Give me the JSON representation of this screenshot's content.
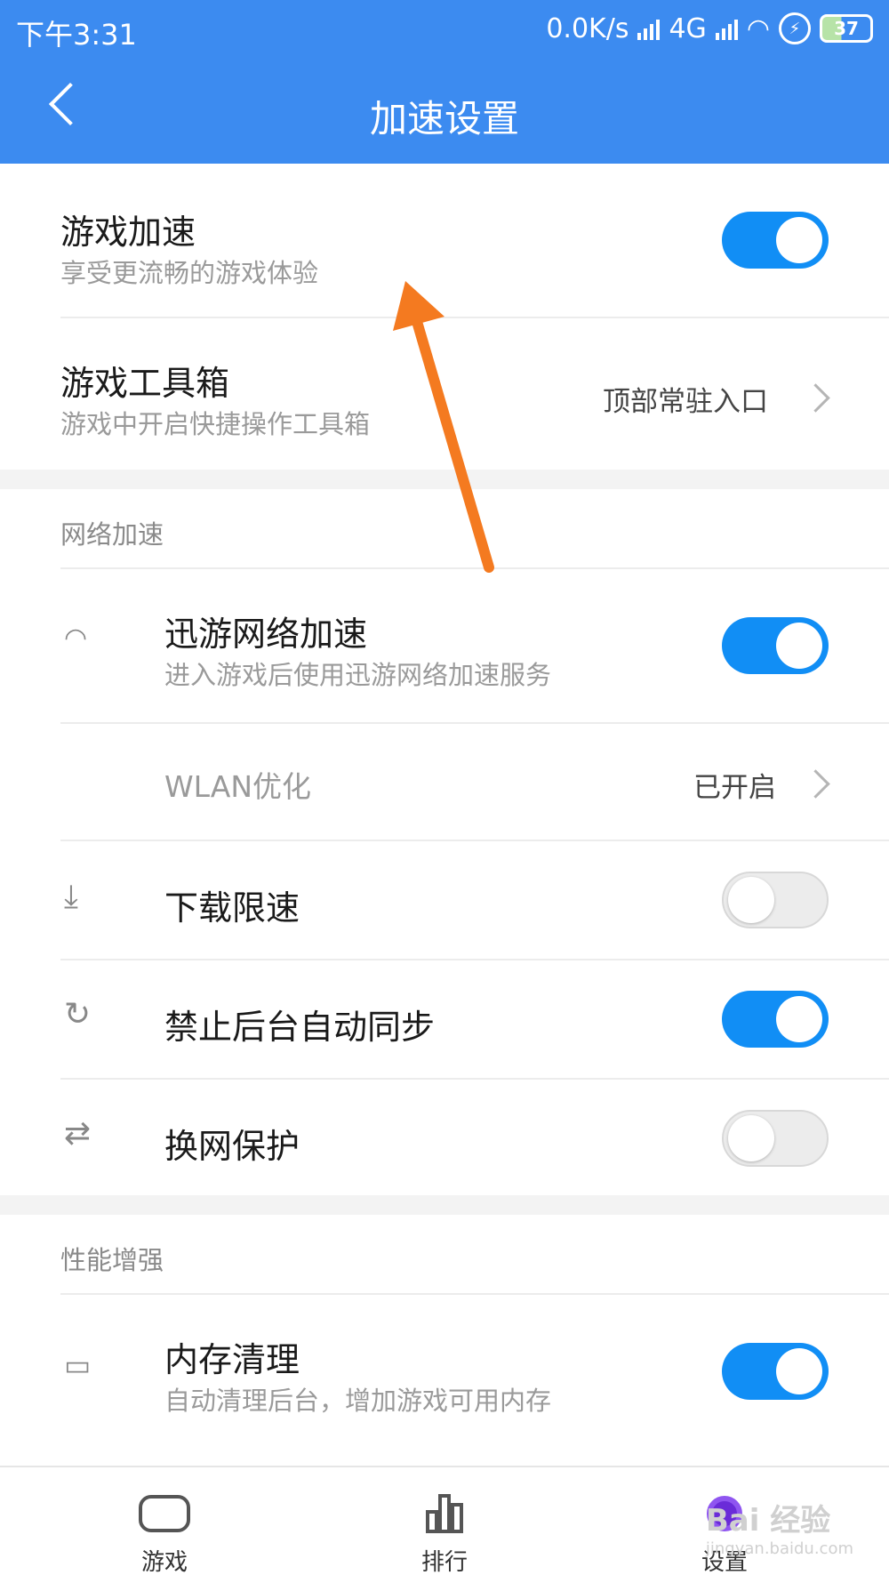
{
  "status_bar": {
    "time": "下午3:31",
    "speed": "0.0K/s",
    "network": "4G",
    "battery": "37"
  },
  "header": {
    "title": "加速设置"
  },
  "rows": {
    "game_boost": {
      "title": "游戏加速",
      "subtitle": "享受更流畅的游戏体验",
      "on": true
    },
    "toolbox": {
      "title": "游戏工具箱",
      "subtitle": "游戏中开启快捷操作工具箱",
      "value": "顶部常驻入口"
    }
  },
  "sections": {
    "network": {
      "label": "网络加速",
      "items": {
        "xunyou": {
          "title": "迅游网络加速",
          "subtitle": "进入游戏后使用迅游网络加速服务",
          "icon": "wifi-icon",
          "on": true
        },
        "wlan": {
          "title": "WLAN优化",
          "value": "已开启"
        },
        "download_limit": {
          "title": "下载限速",
          "icon": "download-icon",
          "on": false
        },
        "bg_sync": {
          "title": "禁止后台自动同步",
          "icon": "sync-icon",
          "on": true
        },
        "net_switch": {
          "title": "换网保护",
          "icon": "swap-icon",
          "on": false
        }
      }
    },
    "performance": {
      "label": "性能增强",
      "items": {
        "memory": {
          "title": "内存清理",
          "subtitle": "自动清理后台，增加游戏可用内存",
          "icon": "memory-icon",
          "on": true
        }
      }
    }
  },
  "bottom_nav": {
    "games": "游戏",
    "ranking": "排行",
    "settings": "设置"
  },
  "watermark": {
    "brand": "Bai 经验",
    "url": "jingyan.baidu.com"
  },
  "colors": {
    "header": "#3c8bf0",
    "toggle_on": "#118ef5",
    "arrow": "#f47a20"
  }
}
